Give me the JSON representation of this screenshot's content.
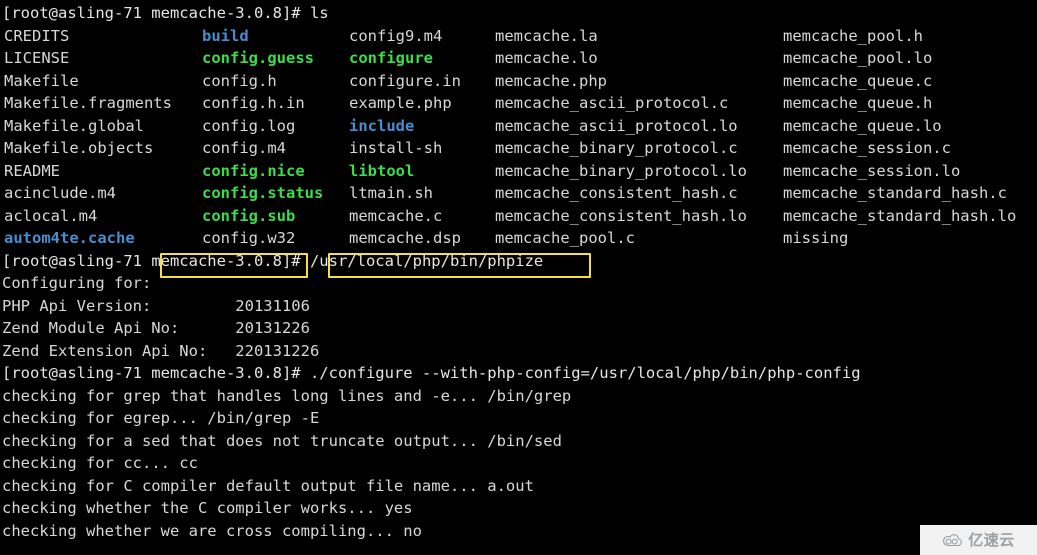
{
  "terminal": {
    "prompt_user_host": "[root@asling-71 ",
    "prompt_dir": "memcache-3.0.8",
    "prompt_tail": "]# ",
    "prompt_full": "[root@asling-71 memcache-3.0.8]# ",
    "colors": {
      "background": "#000000",
      "foreground": "#d8d8d8",
      "directory": "#4b8bd0",
      "executable": "#3ddc4a",
      "highlight_box": "#f2e14c"
    }
  },
  "commands": {
    "ls": "ls",
    "phpize": "/usr/local/php/bin/phpize",
    "configure": "./configure --with-php-config=/usr/local/php/bin/php-config"
  },
  "ls_output": {
    "rows": [
      [
        {
          "text": "CREDITS",
          "kind": "normal"
        },
        {
          "text": "build",
          "kind": "dir"
        },
        {
          "text": "config9.m4",
          "kind": "normal"
        },
        {
          "text": "memcache.la",
          "kind": "normal"
        },
        {
          "text": "memcache_pool.h",
          "kind": "normal"
        }
      ],
      [
        {
          "text": "LICENSE",
          "kind": "normal"
        },
        {
          "text": "config.guess",
          "kind": "exe"
        },
        {
          "text": "configure",
          "kind": "exe"
        },
        {
          "text": "memcache.lo",
          "kind": "normal"
        },
        {
          "text": "memcache_pool.lo",
          "kind": "normal"
        }
      ],
      [
        {
          "text": "Makefile",
          "kind": "normal"
        },
        {
          "text": "config.h",
          "kind": "normal"
        },
        {
          "text": "configure.in",
          "kind": "normal"
        },
        {
          "text": "memcache.php",
          "kind": "normal"
        },
        {
          "text": "memcache_queue.c",
          "kind": "normal"
        }
      ],
      [
        {
          "text": "Makefile.fragments",
          "kind": "normal"
        },
        {
          "text": "config.h.in",
          "kind": "normal"
        },
        {
          "text": "example.php",
          "kind": "normal"
        },
        {
          "text": "memcache_ascii_protocol.c",
          "kind": "normal"
        },
        {
          "text": "memcache_queue.h",
          "kind": "normal"
        }
      ],
      [
        {
          "text": "Makefile.global",
          "kind": "normal"
        },
        {
          "text": "config.log",
          "kind": "normal"
        },
        {
          "text": "include",
          "kind": "dir"
        },
        {
          "text": "memcache_ascii_protocol.lo",
          "kind": "normal"
        },
        {
          "text": "memcache_queue.lo",
          "kind": "normal"
        }
      ],
      [
        {
          "text": "Makefile.objects",
          "kind": "normal"
        },
        {
          "text": "config.m4",
          "kind": "normal"
        },
        {
          "text": "install-sh",
          "kind": "normal"
        },
        {
          "text": "memcache_binary_protocol.c",
          "kind": "normal"
        },
        {
          "text": "memcache_session.c",
          "kind": "normal"
        }
      ],
      [
        {
          "text": "README",
          "kind": "normal"
        },
        {
          "text": "config.nice",
          "kind": "exe"
        },
        {
          "text": "libtool",
          "kind": "exe"
        },
        {
          "text": "memcache_binary_protocol.lo",
          "kind": "normal"
        },
        {
          "text": "memcache_session.lo",
          "kind": "normal"
        }
      ],
      [
        {
          "text": "acinclude.m4",
          "kind": "normal"
        },
        {
          "text": "config.status",
          "kind": "exe"
        },
        {
          "text": "ltmain.sh",
          "kind": "normal"
        },
        {
          "text": "memcache_consistent_hash.c",
          "kind": "normal"
        },
        {
          "text": "memcache_standard_hash.c",
          "kind": "normal"
        }
      ],
      [
        {
          "text": "aclocal.m4",
          "kind": "normal"
        },
        {
          "text": "config.sub",
          "kind": "exe"
        },
        {
          "text": "memcache.c",
          "kind": "normal"
        },
        {
          "text": "memcache_consistent_hash.lo",
          "kind": "normal"
        },
        {
          "text": "memcache_standard_hash.lo",
          "kind": "normal"
        }
      ],
      [
        {
          "text": "autom4te.cache",
          "kind": "dir"
        },
        {
          "text": "config.w32",
          "kind": "normal"
        },
        {
          "text": "memcache.dsp",
          "kind": "normal"
        },
        {
          "text": "memcache_pool.c",
          "kind": "normal"
        },
        {
          "text": "missing",
          "kind": "normal"
        }
      ]
    ]
  },
  "phpize_output": {
    "header": "Configuring for:",
    "lines": [
      "PHP Api Version:         20131106",
      "Zend Module Api No:      20131226",
      "Zend Extension Api No:   220131226"
    ]
  },
  "configure_output": {
    "lines": [
      "checking for grep that handles long lines and -e... /bin/grep",
      "checking for egrep... /bin/grep -E",
      "checking for a sed that does not truncate output... /bin/sed",
      "checking for cc... cc",
      "checking for C compiler default output file name... a.out",
      "checking whether the C compiler works... yes",
      "checking whether we are cross compiling... no"
    ]
  },
  "watermark": {
    "text": "亿速云",
    "icon": "cloud-icon"
  }
}
